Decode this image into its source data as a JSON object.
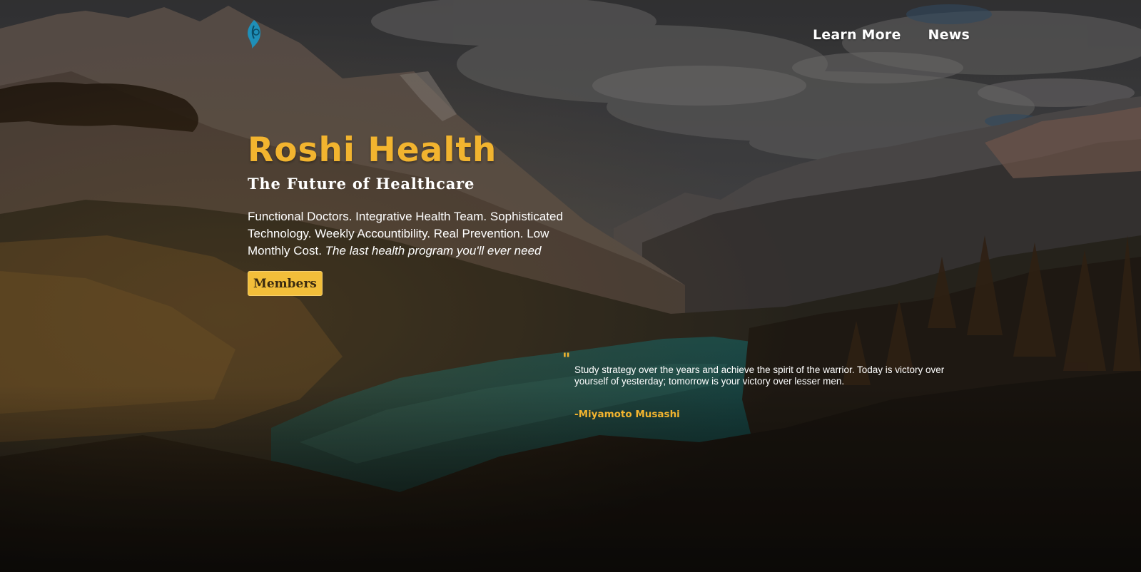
{
  "nav": {
    "logo_icon": "leaf-drop-icon",
    "links": [
      {
        "label": "Learn More"
      },
      {
        "label": "News"
      }
    ]
  },
  "hero": {
    "title": "Roshi Health",
    "subtitle": "The Future of Healthcare",
    "description": "Functional Doctors. Integrative Health Team. Sophisticated Technology. Weekly Accountibility. Real Prevention. Low Monthly Cost.",
    "tagline": "The last health program you'll ever need",
    "button_label": "Members"
  },
  "quote": {
    "mark": "\"",
    "text": "Study strategy over the years and achieve the spirit of the warrior. Today is victory over yourself of yesterday; tomorrow is your victory over lesser men.",
    "author": "-Miyamoto Musashi"
  },
  "colors": {
    "accent": "#f2b42f",
    "button_bg": "#f2be3a",
    "logo": "#1f8fb8",
    "text": "#ffffff"
  }
}
